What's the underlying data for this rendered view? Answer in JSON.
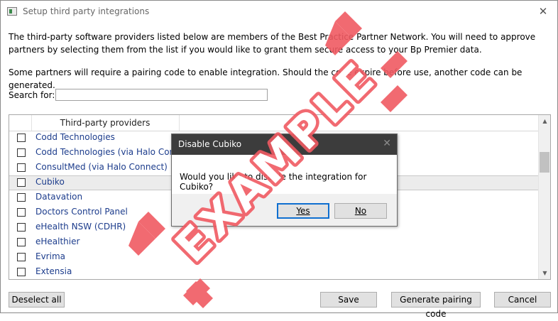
{
  "window": {
    "title": "Setup third party integrations",
    "close_glyph": "✕"
  },
  "intro": {
    "paragraph1": "The third-party software providers listed below are members of the Best Practice Partner Network. You will need to approve partners by selecting them from the list if you would like to grant them secure access to your Bp Premier data.",
    "paragraph2": "Some partners will require a pairing code to enable integration. Should the code expire before use, another code can be generated."
  },
  "search": {
    "label": "Search for:",
    "value": "",
    "placeholder": ""
  },
  "grid": {
    "column_header": "Third-party providers",
    "rows": [
      {
        "name": "Codd Technologies",
        "checked": false,
        "selected": false
      },
      {
        "name": "Codd Technologies (via Halo Connect)",
        "checked": false,
        "selected": false
      },
      {
        "name": "ConsultMed (via Halo Connect)",
        "checked": false,
        "selected": false
      },
      {
        "name": "Cubiko",
        "checked": false,
        "selected": true
      },
      {
        "name": "Datavation",
        "checked": false,
        "selected": false
      },
      {
        "name": "Doctors Control Panel",
        "checked": false,
        "selected": false
      },
      {
        "name": "eHealth NSW (CDHR)",
        "checked": false,
        "selected": false
      },
      {
        "name": "eHealthier",
        "checked": false,
        "selected": false
      },
      {
        "name": "Evrima",
        "checked": false,
        "selected": false
      },
      {
        "name": "Extensia",
        "checked": false,
        "selected": false
      }
    ],
    "scroll_up_glyph": "▲",
    "scroll_down_glyph": "▼"
  },
  "buttons": {
    "deselect_all": "Deselect all",
    "save": "Save",
    "generate_pairing_code": "Generate pairing code",
    "cancel": "Cancel"
  },
  "dialog": {
    "title": "Disable Cubiko",
    "close_glyph": "✕",
    "message": "Would you like to disable the integration for Cubiko?",
    "yes_label": "Yes",
    "no_label": "No"
  },
  "watermark": {
    "text": "EXAMPLE",
    "color": "#f05a62"
  },
  "colors": {
    "link_text": "#1c3c8c",
    "dialog_titlebar": "#3c3c3c",
    "default_button_border": "#0f6fd0"
  }
}
